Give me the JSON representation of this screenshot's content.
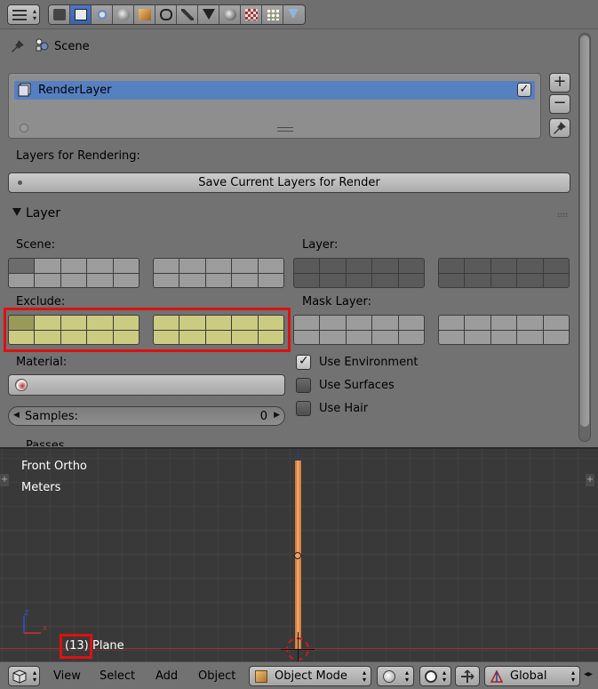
{
  "properties": {
    "context": {
      "scene_label": "Scene"
    },
    "render_layers": {
      "item_name": "RenderLayer",
      "item_enabled": true,
      "add_symbol": "+",
      "remove_symbol": "−"
    },
    "layers_for_rendering_label": "Layers for Rendering:",
    "save_layers_button": "Save Current Layers for Render",
    "layer_panel": {
      "title": "Layer",
      "scene_label": "Scene:",
      "layer_label": "Layer:",
      "exclude_label": "Exclude:",
      "mask_layer_label": "Mask Layer:",
      "material_label": "Material:",
      "samples_label": "Samples:",
      "samples_value": "0",
      "use_environment": "Use Environment",
      "use_surfaces": "Use Surfaces",
      "use_hair": "Use Hair",
      "use_environment_checked": true,
      "use_surfaces_checked": false,
      "use_hair_checked": false
    },
    "next_panel_title": "Passes"
  },
  "viewport": {
    "view_name": "Front Ortho",
    "units": "Meters",
    "frame": "(13)",
    "object_name": "Plane",
    "axis_z": "Z",
    "axis_x": "X"
  },
  "bottom_bar": {
    "menu_view": "View",
    "menu_select": "Select",
    "menu_add": "Add",
    "menu_object": "Object",
    "mode": "Object Mode",
    "orientation": "Global"
  },
  "colors": {
    "selected_blue": "#5680c2",
    "highlight_red": "#e01010",
    "exclude_yellow": "#cbcb82",
    "object_orange": "#f0a060"
  }
}
